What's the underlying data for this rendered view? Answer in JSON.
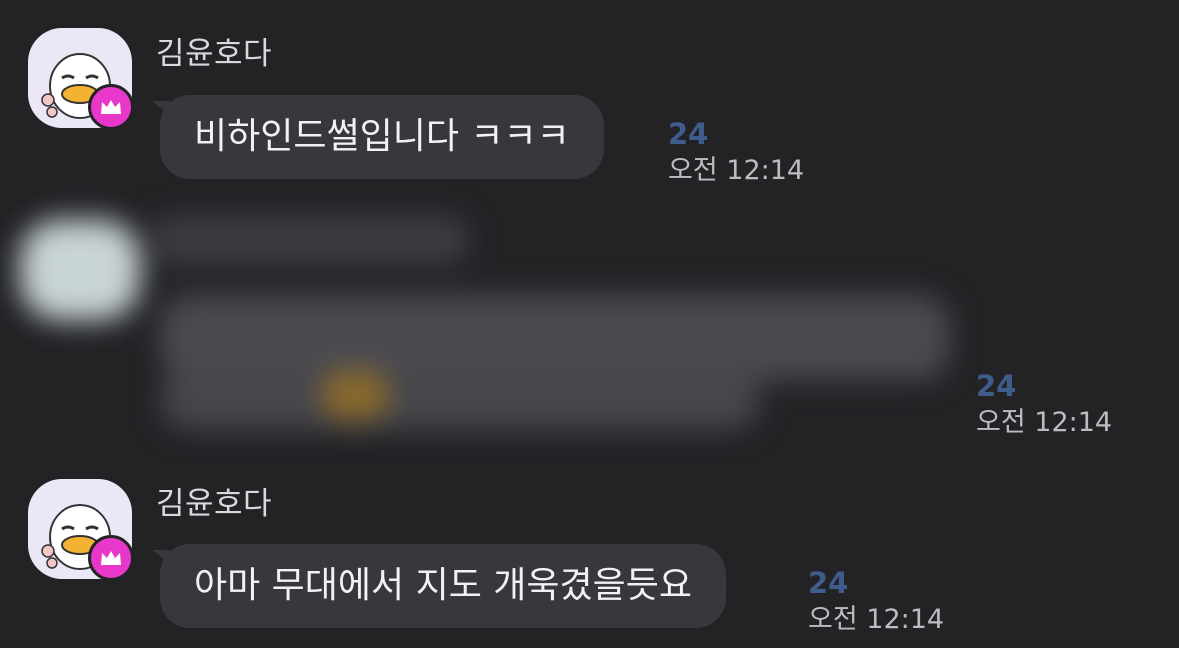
{
  "messages": [
    {
      "sender": "김윤호다",
      "text": "비하인드썰입니다 ㅋㅋㅋ",
      "unread": "24",
      "time": "오전 12:14",
      "avatar_icon": "duck-character-icon",
      "badge_icon": "crown-icon"
    },
    {
      "sender": "",
      "text": "",
      "unread": "24",
      "time": "오전 12:14",
      "blurred": true
    },
    {
      "sender": "김윤호다",
      "text": "아마 무대에서 지도 개욱겼을듯요",
      "unread": "24",
      "time": "오전 12:14",
      "avatar_icon": "duck-character-icon",
      "badge_icon": "crown-icon"
    }
  ],
  "colors": {
    "background": "#232326",
    "bubble": "#38383c",
    "unread": "#3f5c8c",
    "badge": "#e838c9",
    "avatar_bg": "#ebe7f6"
  }
}
